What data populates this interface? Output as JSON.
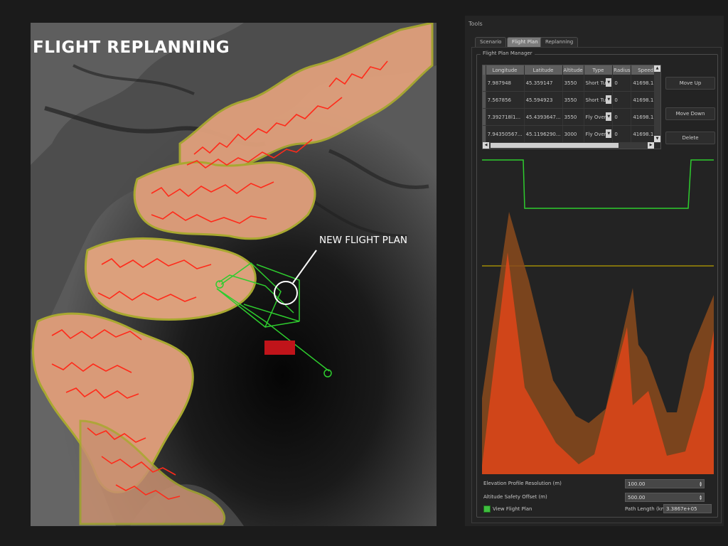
{
  "map": {
    "title": "FLIGHT REPLANNING",
    "callout": "NEW FLIGHT PLAN"
  },
  "tools": {
    "label": "Tools",
    "tabs": [
      {
        "label": "Scenario",
        "active": false
      },
      {
        "label": "Flight Plan",
        "active": true
      },
      {
        "label": "Replanning",
        "active": false
      }
    ],
    "group_title": "Flight Plan Manager",
    "table": {
      "columns": [
        "Longitude",
        "Latitude",
        "Altitude",
        "Type",
        "Radius",
        "Speed"
      ],
      "rows": [
        {
          "longitude": "7.987948",
          "latitude": "45.359147",
          "altitude": "3550",
          "type": "Short Turn",
          "radius": "0",
          "speed": "41698.1..."
        },
        {
          "longitude": "7.567856",
          "latitude": "45.594923",
          "altitude": "3550",
          "type": "Short Turn",
          "radius": "0",
          "speed": "41698.1..."
        },
        {
          "longitude": "7.392718l1...",
          "latitude": "45.4393647...",
          "altitude": "3550",
          "type": "Fly Over",
          "radius": "0",
          "speed": "41698.1..."
        },
        {
          "longitude": "7.94350567...",
          "latitude": "45.1196290...",
          "altitude": "3000",
          "type": "Fly Over",
          "radius": "0",
          "speed": "41698.1..."
        }
      ]
    },
    "buttons": {
      "move_up": "Move Up",
      "move_down": "Move Down",
      "delete": "Delete"
    },
    "controls": {
      "elevation_label": "Elevation Profile Resolution (m)",
      "elevation_value": "100.00",
      "altitude_label": "Altitude Safety Offset (m)",
      "altitude_value": "500.00",
      "view_label": "View Flight Plan",
      "view_checked": true,
      "path_label": "Path Length (km)",
      "path_value": "3.3867e+05"
    }
  },
  "colors": {
    "flight_path": "#2ecc2e",
    "safety_line": "#b9a000",
    "terrain_profile": "#d9461a",
    "safety_profile": "#a45a1e",
    "ridge_outline": "#ff2a1a",
    "zone_fill": "#e8a880"
  }
}
